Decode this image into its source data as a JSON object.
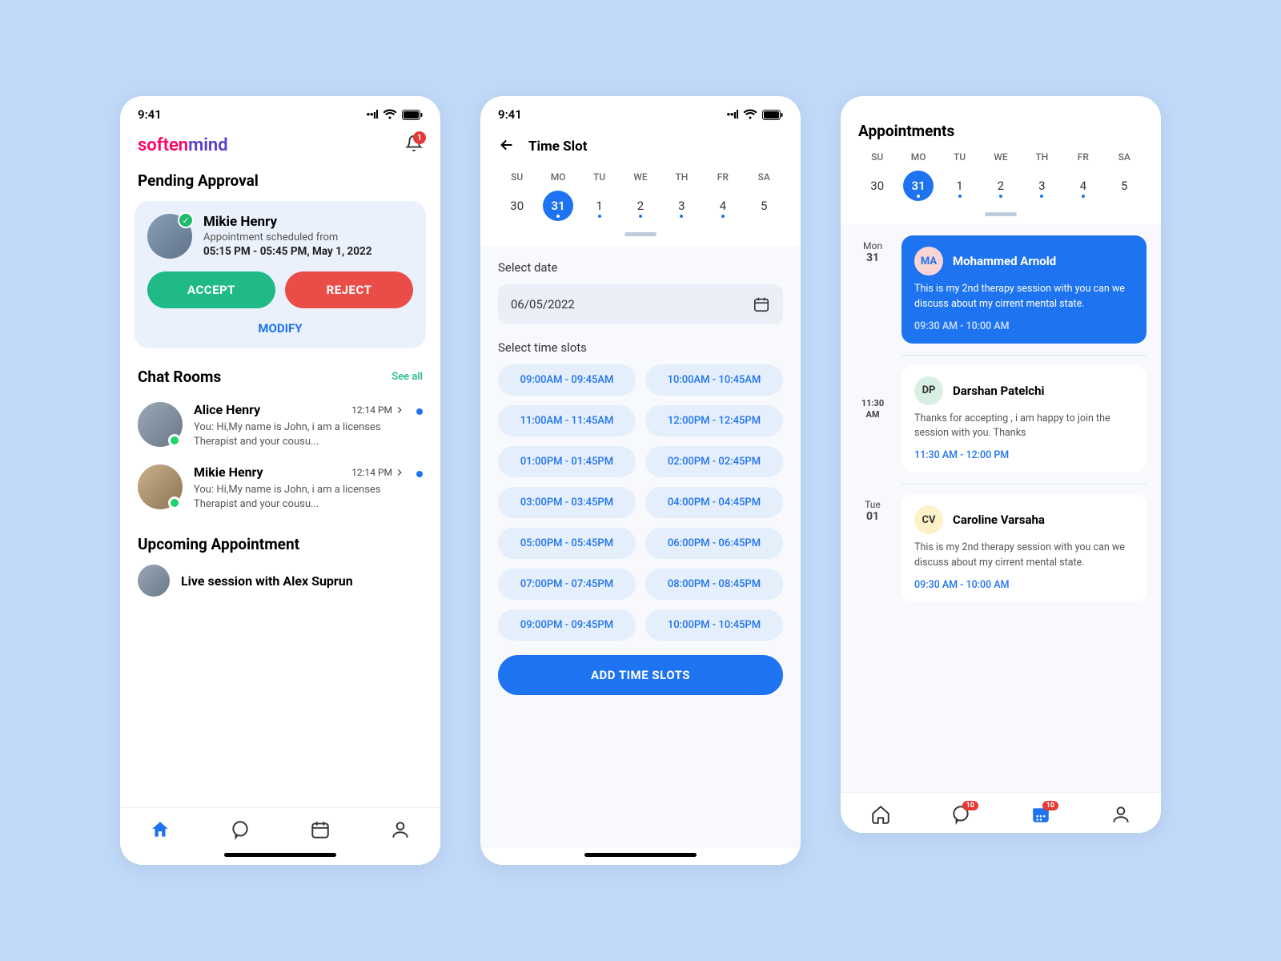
{
  "status": {
    "time": "9:41"
  },
  "brand_left": "soften",
  "brand_right": "mind",
  "notif_badge": "1",
  "screen1": {
    "pending_title": "Pending Approval",
    "pending": {
      "name": "Mikie Henry",
      "sub": "Appointment scheduled from",
      "time": "05:15 PM - 05:45 PM, May 1, 2022",
      "accept": "ACCEPT",
      "reject": "REJECT",
      "modify": "MODIFY"
    },
    "chat_title": "Chat Rooms",
    "see_all": "See all",
    "chats": [
      {
        "name": "Alice Henry",
        "time": "12:14 PM",
        "msg": "You: Hi,My name is John, i am a licenses Therapist and your cousu..."
      },
      {
        "name": "Mikie Henry",
        "time": "12:14 PM",
        "msg": "You: Hi,My name is John, i am a licenses Therapist and your cousu..."
      }
    ],
    "upcoming_title": "Upcoming Appointment",
    "live": "Live session with Alex Suprun"
  },
  "week": {
    "labels": [
      "SU",
      "MO",
      "TU",
      "WE",
      "TH",
      "FR",
      "SA"
    ],
    "nums": [
      "30",
      "31",
      "1",
      "2",
      "3",
      "4",
      "5"
    ],
    "selected_index": 1,
    "dot_indices": [
      1,
      2,
      3,
      4,
      5
    ]
  },
  "screen2": {
    "title": "Time Slot",
    "select_date_label": "Select date",
    "date_value": "06/05/2022",
    "select_slots_label": "Select time slots",
    "slots": [
      "09:00AM - 09:45AM",
      "10:00AM - 10:45AM",
      "11:00AM - 11:45AM",
      "12:00PM - 12:45PM",
      "01:00PM - 01:45PM",
      "02:00PM - 02:45PM",
      "03:00PM - 03:45PM",
      "04:00PM - 04:45PM",
      "05:00PM - 05:45PM",
      "06:00PM - 06:45PM",
      "07:00PM - 07:45PM",
      "08:00PM - 08:45PM",
      "09:00PM - 09:45PM",
      "10:00PM - 10:45PM"
    ],
    "add_button": "ADD TIME SLOTS"
  },
  "screen3": {
    "title": "Appointments",
    "items": [
      {
        "dow": "Mon",
        "dnum": "31",
        "initials": "MA",
        "av_bg": "#fbd5d5",
        "av_fg": "#1e73f0",
        "name": "Mohammed Arnold",
        "msg": "This is my 2nd therapy session with you can we discuss about my cirrent mental state.",
        "time": "09:30 AM - 10:00 AM",
        "primary": true
      },
      {
        "dow": "",
        "dnum": "11:30 AM",
        "initials": "DP",
        "av_bg": "#d8f0e4",
        "av_fg": "#333",
        "name": "Darshan Patelchi",
        "msg": "Thanks for accepting , i am happy to join the session with you. Thanks",
        "time": "11:30 AM - 12:00 PM",
        "primary": false
      },
      {
        "dow": "Tue",
        "dnum": "01",
        "initials": "CV",
        "av_bg": "#fdf1c8",
        "av_fg": "#333",
        "name": "Caroline Varsaha",
        "msg": "This is my 2nd therapy session with you can we discuss about my cirrent mental state.",
        "time": "09:30 AM - 10:00 AM",
        "primary": false
      }
    ],
    "tab_badges": {
      "chat": "10",
      "calendar": "10"
    }
  }
}
